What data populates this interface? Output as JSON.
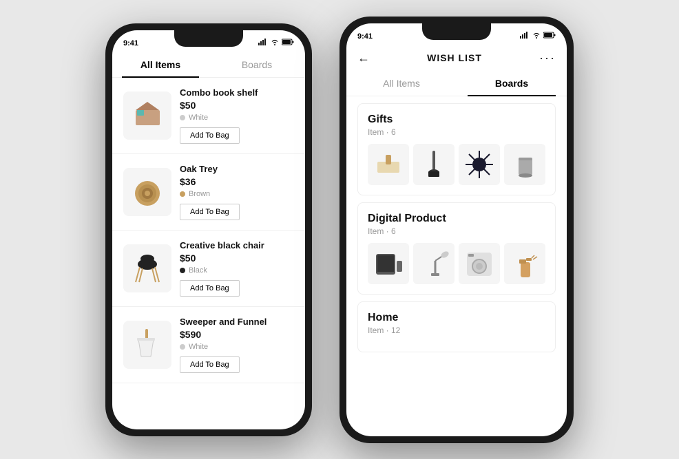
{
  "leftPhone": {
    "status": {
      "time": "9:41",
      "signal": "▌▌▌",
      "wifi": "WiFi",
      "battery": "🔋"
    },
    "tabs": [
      {
        "label": "All Items",
        "active": true
      },
      {
        "label": "Boards",
        "active": false
      }
    ],
    "items": [
      {
        "name": "Combo book shelf",
        "price": "$50",
        "color": "White",
        "colorHex": "#ccc",
        "buttonLabel": "Add To Bag"
      },
      {
        "name": "Oak Trey",
        "price": "$36",
        "color": "Brown",
        "colorHex": "#c8a060",
        "buttonLabel": "Add To Bag"
      },
      {
        "name": "Creative black chair",
        "price": "$50",
        "color": "Black",
        "colorHex": "#222",
        "buttonLabel": "Add To Bag"
      },
      {
        "name": "Sweeper and Funnel",
        "price": "$590",
        "color": "White",
        "colorHex": "#ccc",
        "buttonLabel": "Add To Bag"
      }
    ]
  },
  "rightPhone": {
    "status": {
      "time": "9:41"
    },
    "header": {
      "title": "WISH LIST",
      "backLabel": "←",
      "moreLabel": "···"
    },
    "tabs": [
      {
        "label": "All Items",
        "active": false
      },
      {
        "label": "Boards",
        "active": true
      }
    ],
    "boards": [
      {
        "title": "Gifts",
        "count": "Item · 6",
        "thumbs": [
          "brush",
          "broom",
          "flower",
          "cup"
        ]
      },
      {
        "title": "Digital Product",
        "count": "Item · 6",
        "thumbs": [
          "tablet",
          "lamp-desk",
          "washer",
          "spray"
        ]
      },
      {
        "title": "Home",
        "count": "Item · 12",
        "thumbs": []
      }
    ]
  }
}
